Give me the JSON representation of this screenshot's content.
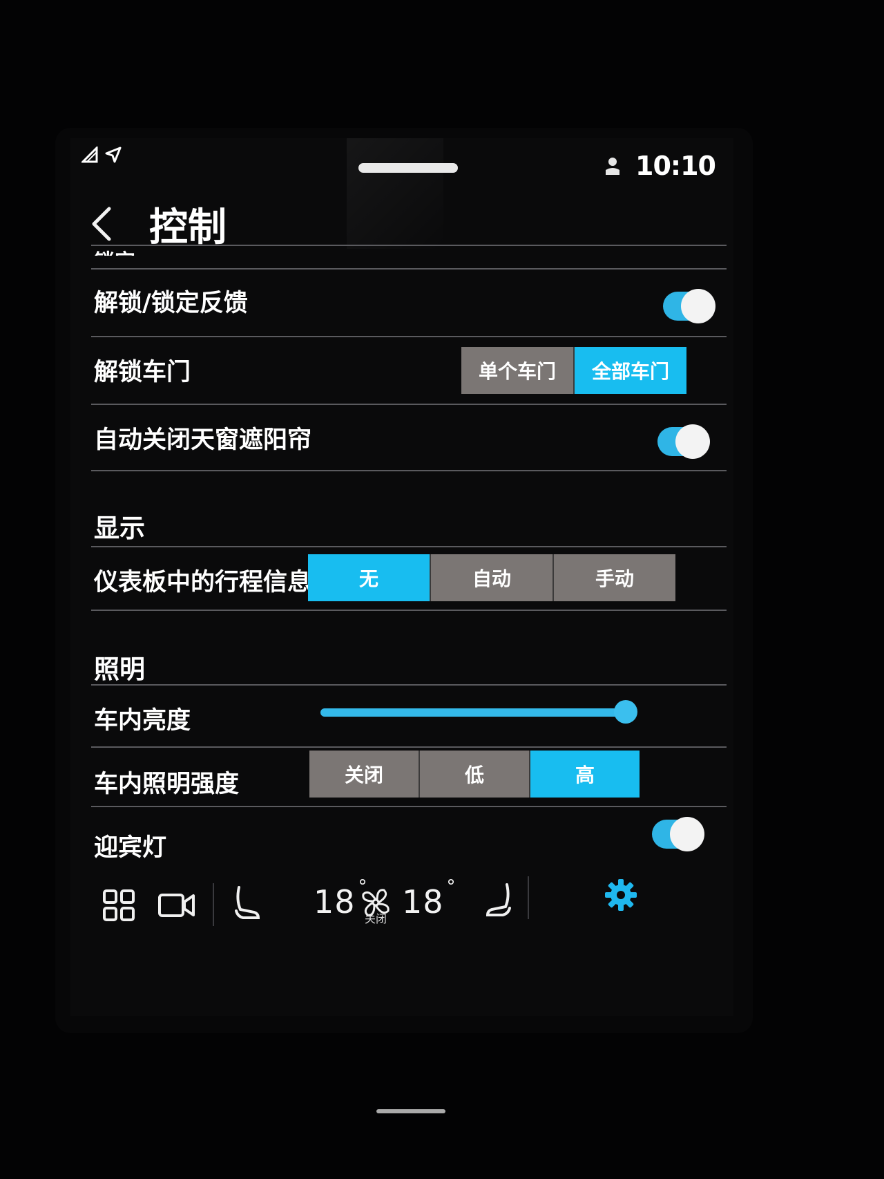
{
  "status_bar": {
    "time": "10:10"
  },
  "header": {
    "title": "控制"
  },
  "lock_section": {
    "partial_title": "锁定"
  },
  "rows": {
    "unlock_feedback": {
      "label": "解锁/锁定反馈",
      "enabled": true
    },
    "unlock_doors": {
      "label": "解锁车门",
      "options": [
        "单个车门",
        "全部车门"
      ],
      "selected": 1
    },
    "auto_close_sunshade": {
      "label": "自动关闭天窗遮阳帘",
      "enabled": true
    }
  },
  "display_section": {
    "title": "显示",
    "trip_info": {
      "label": "仪表板中的行程信息",
      "options": [
        "无",
        "自动",
        "手动"
      ],
      "selected": 0
    }
  },
  "lighting_section": {
    "title": "照明",
    "brightness": {
      "label": "车内亮度",
      "value_fraction": 0.96
    },
    "intensity": {
      "label": "车内照明强度",
      "options": [
        "关闭",
        "低",
        "高"
      ],
      "selected": 2
    },
    "welcome_light": {
      "label": "迎宾灯",
      "enabled": true
    }
  },
  "climate_bar": {
    "left_temp": "18",
    "right_temp": "18",
    "degree": "°",
    "fan_status": "关闭"
  },
  "colors": {
    "accent": "#18bdf0",
    "segment_bg": "#7b7674",
    "background": "#0a0a0b"
  },
  "icons": [
    "app-grid-icon",
    "camera-icon",
    "seat-left-icon",
    "fan-icon",
    "seat-right-icon",
    "settings-gear-icon"
  ]
}
